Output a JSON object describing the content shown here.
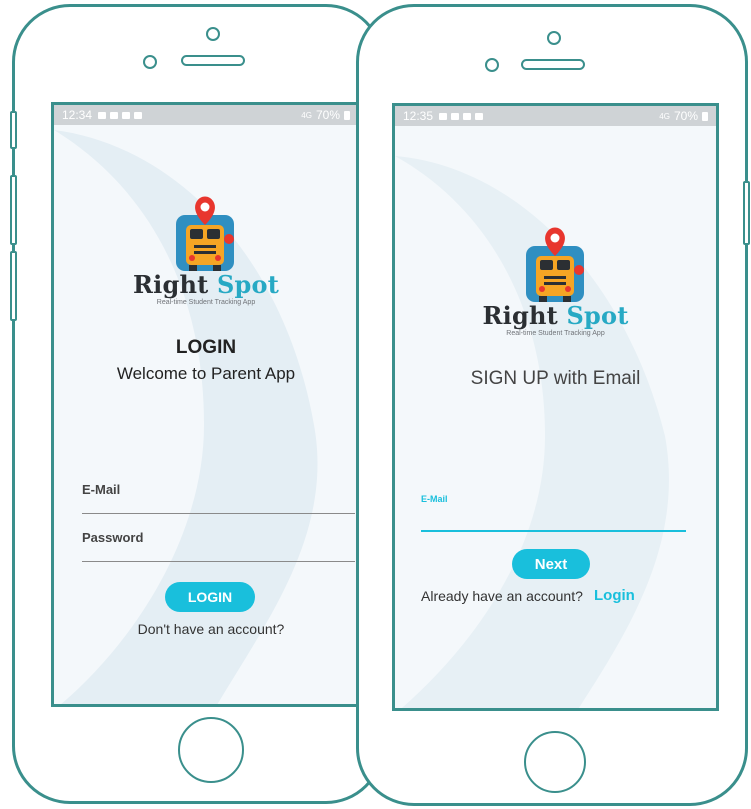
{
  "colors": {
    "frame": "#3a8f8c",
    "accent": "#19bfdc",
    "logo_dark": "#2b2f33",
    "logo_blue": "#27a9c4"
  },
  "left_phone": {
    "status_bar": {
      "time": "12:34",
      "signal": "4G",
      "battery": "70%"
    },
    "logo": {
      "word1": "Right",
      "word2": "Spot",
      "tagline": "Real-time Student Tracking App",
      "icon": "school-bus-location-icon"
    },
    "title": "LOGIN",
    "subtitle": "Welcome to Parent App",
    "email_label": "E-Mail",
    "password_label": "Password",
    "login_button": "LOGIN",
    "signup_prompt": "Don't have an account?"
  },
  "right_phone": {
    "status_bar": {
      "time": "12:35",
      "signal": "4G",
      "battery": "70%"
    },
    "logo": {
      "word1": "Right",
      "word2": "Spot",
      "tagline": "Real-time Student Tracking App",
      "icon": "school-bus-location-icon"
    },
    "title": "SIGN UP with Email",
    "email_label": "E-Mail",
    "next_button": "Next",
    "login_prompt": "Already have an account?",
    "login_link": "Login"
  }
}
